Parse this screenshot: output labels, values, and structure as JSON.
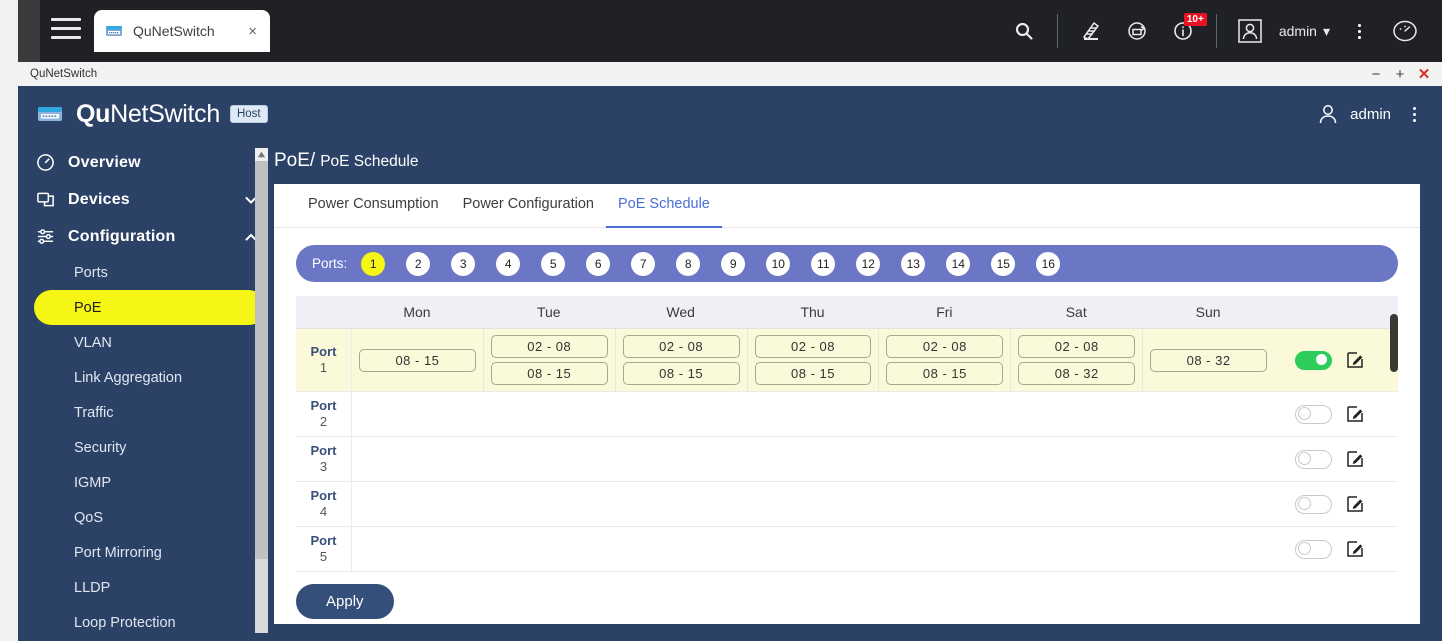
{
  "browser": {
    "tab_title": "QuNetSwitch",
    "tab_close": "×",
    "hamburger_icon": "hamburger-menu-icon",
    "icons": [
      {
        "name": "search-icon",
        "glyph": "search"
      },
      {
        "name": "logs-icon",
        "glyph": "logs"
      },
      {
        "name": "refresh-icon",
        "glyph": "refresh"
      },
      {
        "name": "notifications-icon",
        "glyph": "info",
        "badge": "10+"
      },
      {
        "name": "user-avatar-icon",
        "glyph": "user-box"
      },
      {
        "name": "kebab-menu-icon",
        "glyph": "kebab"
      },
      {
        "name": "dashboard-icon",
        "glyph": "gauge"
      }
    ],
    "user_label": "admin",
    "user_caret": "▾"
  },
  "window": {
    "title": "QuNetSwitch",
    "minimize": "−",
    "maximize": "+",
    "close": "✕"
  },
  "app_header": {
    "brand_bold": "Qu",
    "brand_light": "NetSwitch",
    "host_badge": "Host",
    "user": "admin"
  },
  "sidebar": {
    "items": [
      {
        "label": "Overview",
        "icon": "gauge-icon",
        "type": "top",
        "chevron": null,
        "active": false
      },
      {
        "label": "Devices",
        "icon": "devices-icon",
        "type": "top",
        "chevron": "down",
        "active": false
      },
      {
        "label": "Configuration",
        "icon": "sliders-icon",
        "type": "top",
        "chevron": "up",
        "active": false
      },
      {
        "label": "Ports",
        "type": "sub",
        "active": false
      },
      {
        "label": "PoE",
        "type": "sub",
        "active": true
      },
      {
        "label": "VLAN",
        "type": "sub",
        "active": false
      },
      {
        "label": "Link Aggregation",
        "type": "sub",
        "active": false
      },
      {
        "label": "Traffic",
        "type": "sub",
        "active": false
      },
      {
        "label": "Security",
        "type": "sub",
        "active": false
      },
      {
        "label": "IGMP",
        "type": "sub",
        "active": false
      },
      {
        "label": "QoS",
        "type": "sub",
        "active": false
      },
      {
        "label": "Port Mirroring",
        "type": "sub",
        "active": false
      },
      {
        "label": "LLDP",
        "type": "sub",
        "active": false
      },
      {
        "label": "Loop Protection",
        "type": "sub",
        "active": false
      }
    ]
  },
  "breadcrumb": {
    "root": "PoE/",
    "current": "PoE Schedule"
  },
  "tabs": [
    {
      "label": "Power Consumption",
      "active": false
    },
    {
      "label": "Power Configuration",
      "active": false
    },
    {
      "label": "PoE Schedule",
      "active": true
    }
  ],
  "ports_selector": {
    "label": "Ports:",
    "ports": [
      "1",
      "2",
      "3",
      "4",
      "5",
      "6",
      "7",
      "8",
      "9",
      "10",
      "11",
      "12",
      "13",
      "14",
      "15",
      "16"
    ],
    "selected": "1"
  },
  "schedule": {
    "days": [
      "Mon",
      "Tue",
      "Wed",
      "Thu",
      "Fri",
      "Sat",
      "Sun"
    ],
    "rows": [
      {
        "port_label": "Port",
        "port_number": "1",
        "highlighted": true,
        "enabled": true,
        "cells": [
          [
            "08 - 15"
          ],
          [
            "02 - 08",
            "08 - 15"
          ],
          [
            "02 - 08",
            "08 - 15"
          ],
          [
            "02 - 08",
            "08 - 15"
          ],
          [
            "02 - 08",
            "08 - 15"
          ],
          [
            "02 - 08",
            "08 - 32"
          ],
          [
            "08 - 32"
          ]
        ]
      },
      {
        "port_label": "Port",
        "port_number": "2",
        "highlighted": false,
        "enabled": false,
        "cells": [
          [],
          [],
          [],
          [],
          [],
          [],
          []
        ]
      },
      {
        "port_label": "Port",
        "port_number": "3",
        "highlighted": false,
        "enabled": false,
        "cells": [
          [],
          [],
          [],
          [],
          [],
          [],
          []
        ]
      },
      {
        "port_label": "Port",
        "port_number": "4",
        "highlighted": false,
        "enabled": false,
        "cells": [
          [],
          [],
          [],
          [],
          [],
          [],
          []
        ]
      },
      {
        "port_label": "Port",
        "port_number": "5",
        "highlighted": false,
        "enabled": false,
        "cells": [
          [],
          [],
          [],
          [],
          [],
          [],
          []
        ]
      }
    ],
    "edit_icon": "edit-pencil-icon",
    "toggle_icon": "toggle-switch"
  },
  "actions": {
    "apply_label": "Apply"
  },
  "colors": {
    "app_bg": "#2b4166",
    "accent_blue": "#4a6fd4",
    "highlight_yellow": "#f5f516",
    "row_highlight": "#faf9d9",
    "ports_bar": "#6b77c4",
    "toggle_on": "#2ecc5b",
    "badge_red": "#e81123",
    "apply_button": "#344f7a"
  }
}
